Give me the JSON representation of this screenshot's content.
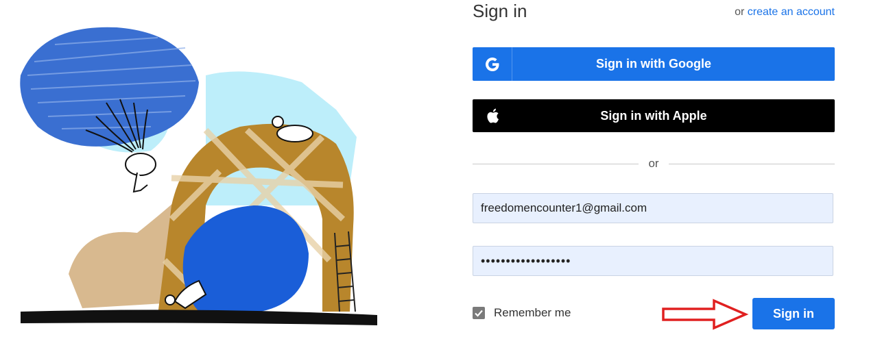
{
  "header": {
    "title": "Sign in",
    "create_prefix": "or",
    "create_link": "create an account"
  },
  "buttons": {
    "google": "Sign in with Google",
    "apple": "Sign in with Apple",
    "submit": "Sign in"
  },
  "divider": {
    "label": "or"
  },
  "form": {
    "email_value": "freedomencounter1@gmail.com",
    "password_value": "••••••••••••••••••",
    "remember_label": "Remember me",
    "remember_checked": true
  },
  "colors": {
    "brand_blue": "#1a73e8",
    "apple_black": "#000000",
    "field_bg": "#e8f0fe",
    "annotation_red": "#e02020"
  },
  "icons": {
    "google": "google-g-icon",
    "apple": "apple-logo-icon",
    "check": "checkmark-icon",
    "annotation": "red-arrow-icon"
  }
}
